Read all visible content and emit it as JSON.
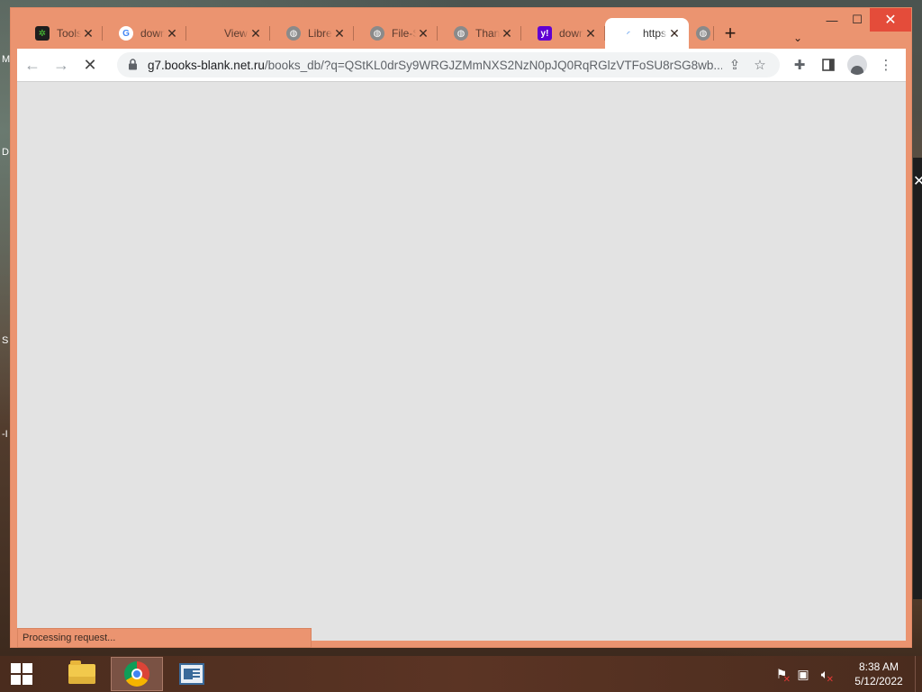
{
  "desktop": {
    "edge_letters": [
      "M",
      "D",
      "S",
      "-I"
    ]
  },
  "window": {
    "caption": {
      "minimize_glyph": "—",
      "maximize_glyph": "☐",
      "close_glyph": "✕"
    },
    "tabs": [
      {
        "title": "Tools",
        "icon": "gear-green-icon"
      },
      {
        "title": "down",
        "icon": "google-icon"
      },
      {
        "title": "View",
        "icon": "blank-icon"
      },
      {
        "title": "Libre",
        "icon": "globe-icon"
      },
      {
        "title": "File-S",
        "icon": "globe-icon"
      },
      {
        "title": "Thank",
        "icon": "globe-icon"
      },
      {
        "title": "down",
        "icon": "yahoo-icon"
      },
      {
        "title": "https",
        "icon": "loading-icon",
        "active": true
      }
    ],
    "new_tab_glyph": "+",
    "tab_search_glyph": "⌄",
    "toolbar": {
      "url_host": "g7.books-blank.net.ru",
      "url_rest": "/books_db/?q=QStKL0drSy9WRGJZMmNXS2NzN0pJQ0RqRGlzVTFoSU8rSG8wb..."
    },
    "status_text": "Processing request..."
  },
  "taskbar": {
    "apps": [
      {
        "name": "file-explorer",
        "active": false
      },
      {
        "name": "chrome",
        "active": true
      },
      {
        "name": "paint",
        "active": false
      }
    ],
    "clock_time": "8:38 AM",
    "clock_date": "5/12/2022"
  },
  "colors": {
    "frame": "#eb9470",
    "content_bg": "#e3e3e3",
    "close_btn": "#e44c3a"
  }
}
